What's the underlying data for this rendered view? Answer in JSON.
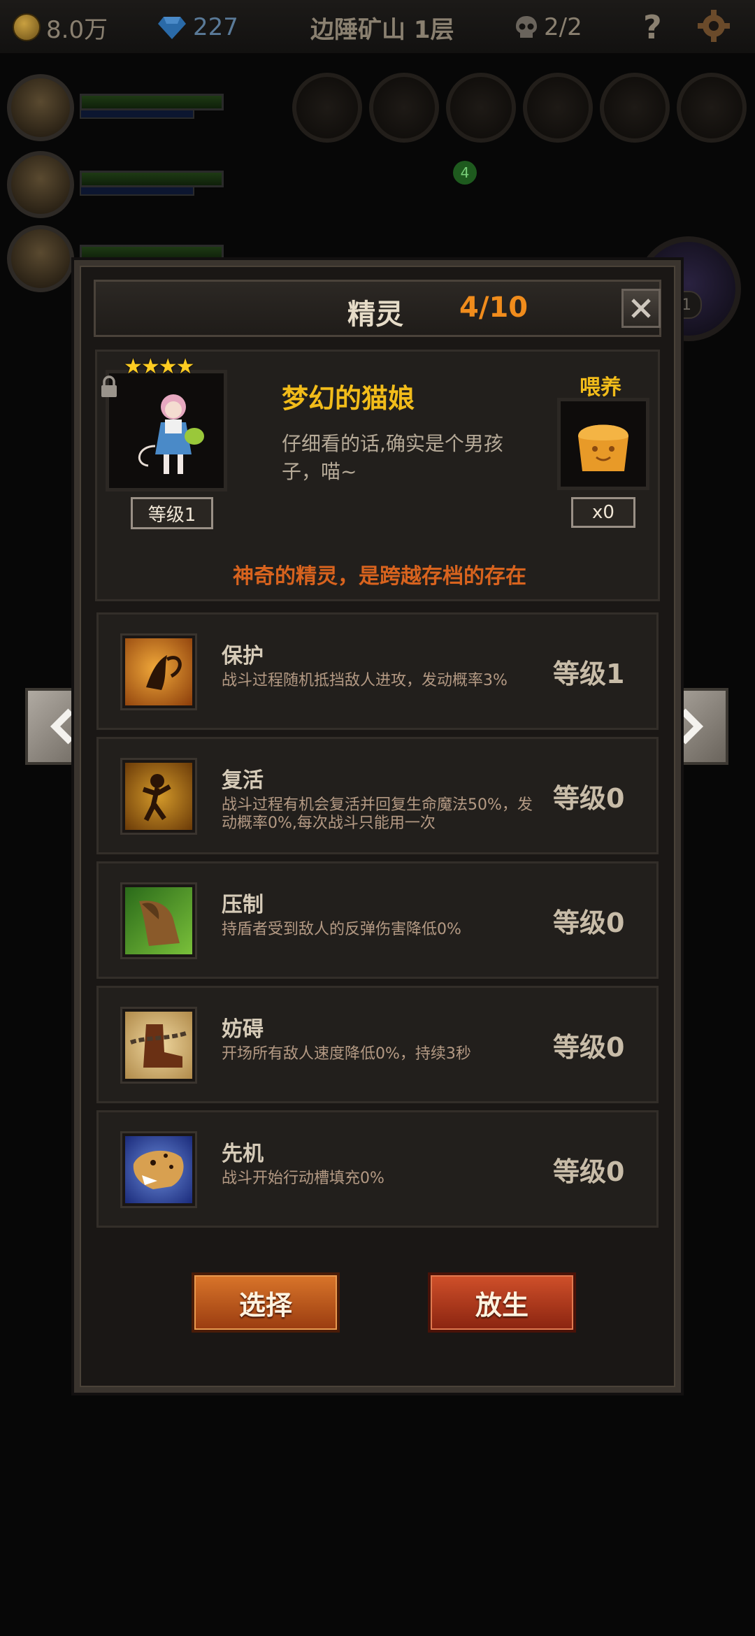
{
  "topbar": {
    "gold": "8.0万",
    "gems": "227",
    "location": "边陲矿山 1层",
    "skull_count": "2/2",
    "help": "?"
  },
  "dialog": {
    "title": "精灵",
    "count": "4/10",
    "spirit": {
      "stars": "★★★★",
      "name": "梦幻的猫娘",
      "description": "仔细看的话,确实是个男孩子，喵~",
      "level": "等级1",
      "feed_label": "喂养",
      "feed_count": "x0",
      "tagline": "神奇的精灵，是跨越存档的存在"
    },
    "skills": [
      {
        "name": "保护",
        "desc": "战斗过程随机抵挡敌人进攻，发动概率3%",
        "level": "等级1",
        "icon": "fairy-icon"
      },
      {
        "name": "复活",
        "desc": "战斗过程有机会复活并回复生命魔法50%，发动概率0%,每次战斗只能用一次",
        "level": "等级0",
        "icon": "monkey-icon"
      },
      {
        "name": "压制",
        "desc": "持盾者受到敌人的反弹伤害降低0%",
        "level": "等级0",
        "icon": "lion-paw-icon"
      },
      {
        "name": "妨碍",
        "desc": "开场所有敌人速度降低0%，持续3秒",
        "level": "等级0",
        "icon": "chained-boot-icon"
      },
      {
        "name": "先机",
        "desc": "战斗开始行动槽填充0%",
        "level": "等级0",
        "icon": "leopard-icon"
      }
    ],
    "buttons": {
      "select": "选择",
      "release": "放生"
    }
  },
  "background_ui": {
    "notification_badge": "4",
    "boss_badge": "1"
  }
}
